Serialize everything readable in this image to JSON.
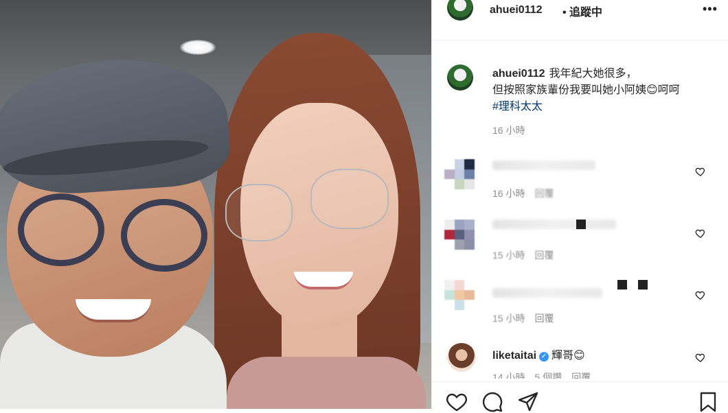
{
  "header": {
    "username": "ahuei0112",
    "follow_status": "• 追蹤中",
    "more_icon": "more-dots-icon"
  },
  "caption": {
    "username": "ahuei0112",
    "line1": "我年紀大她很多，",
    "line2": "但按照家族輩份我要叫她小阿姨😊呵呵",
    "hashtag": "#理科太太",
    "time": "16 小時"
  },
  "comments": [
    {
      "time": "16 小時",
      "reply": "回覆"
    },
    {
      "time": "15 小時",
      "reply": "回覆"
    },
    {
      "time": "15 小時",
      "reply": "回覆"
    }
  ],
  "featured_comment": {
    "username": "liketaitai",
    "verified": true,
    "text": "輝哥😊",
    "time": "14 小時",
    "likes": "5 個讚",
    "reply": "回覆"
  },
  "actions": [
    "like-icon",
    "comment-icon",
    "share-icon",
    "bookmark-icon"
  ],
  "colors": {
    "link": "#00376b",
    "meta": "#8e8e8e",
    "verified": "#3897f0"
  }
}
